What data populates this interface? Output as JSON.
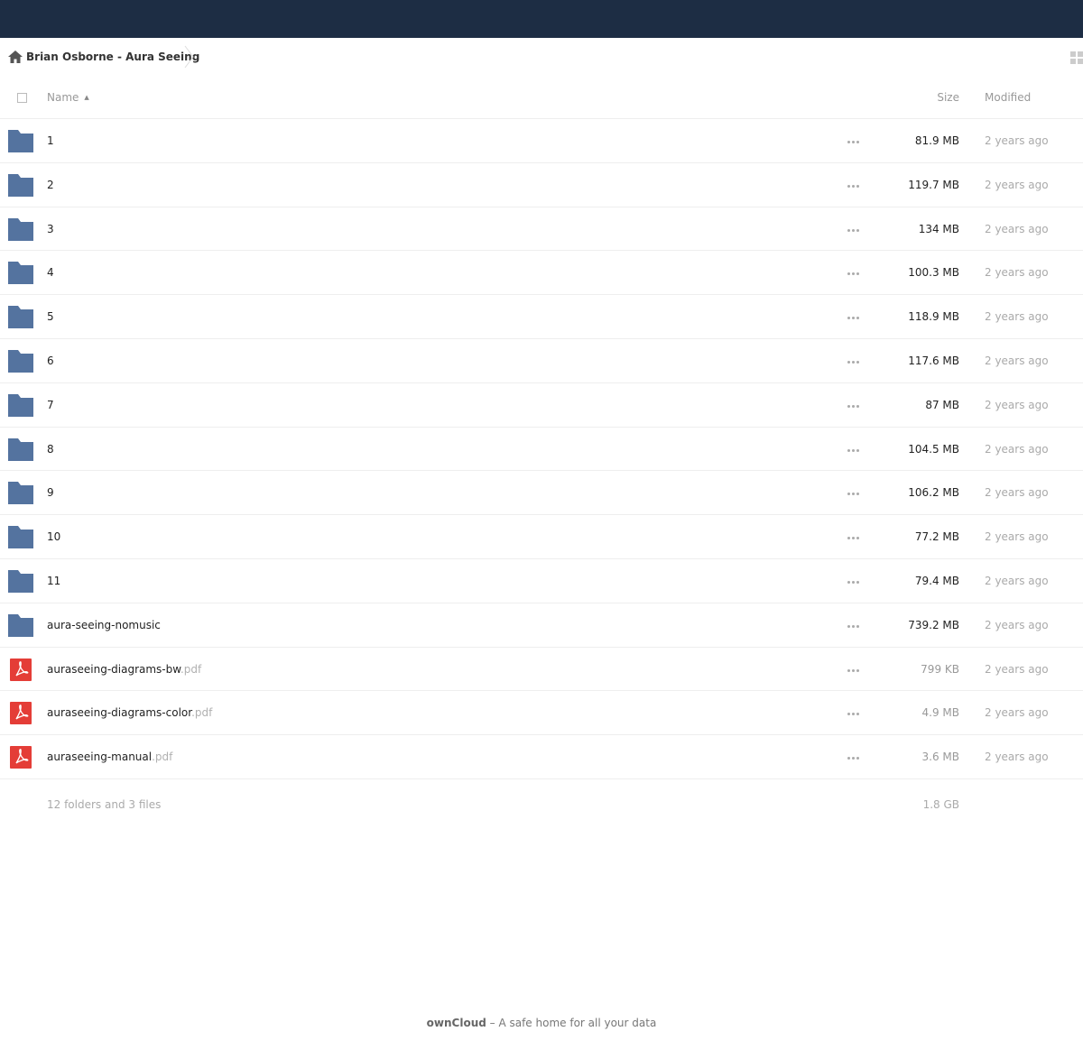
{
  "breadcrumb": {
    "home_icon": "home-icon",
    "folder": "Brian Osborne - Aura Seeing"
  },
  "header": {
    "name": "Name",
    "size": "Size",
    "modified": "Modified"
  },
  "colors": {
    "topbar": "#1d2d44",
    "folder": "#54739f",
    "pdf": "#e43d37"
  },
  "files": [
    {
      "name": "1",
      "ext": "",
      "type": "folder",
      "size": "81.9 MB",
      "modified": "2 years ago"
    },
    {
      "name": "2",
      "ext": "",
      "type": "folder",
      "size": "119.7 MB",
      "modified": "2 years ago"
    },
    {
      "name": "3",
      "ext": "",
      "type": "folder",
      "size": "134 MB",
      "modified": "2 years ago"
    },
    {
      "name": "4",
      "ext": "",
      "type": "folder",
      "size": "100.3 MB",
      "modified": "2 years ago"
    },
    {
      "name": "5",
      "ext": "",
      "type": "folder",
      "size": "118.9 MB",
      "modified": "2 years ago"
    },
    {
      "name": "6",
      "ext": "",
      "type": "folder",
      "size": "117.6 MB",
      "modified": "2 years ago"
    },
    {
      "name": "7",
      "ext": "",
      "type": "folder",
      "size": "87 MB",
      "modified": "2 years ago"
    },
    {
      "name": "8",
      "ext": "",
      "type": "folder",
      "size": "104.5 MB",
      "modified": "2 years ago"
    },
    {
      "name": "9",
      "ext": "",
      "type": "folder",
      "size": "106.2 MB",
      "modified": "2 years ago"
    },
    {
      "name": "10",
      "ext": "",
      "type": "folder",
      "size": "77.2 MB",
      "modified": "2 years ago"
    },
    {
      "name": "11",
      "ext": "",
      "type": "folder",
      "size": "79.4 MB",
      "modified": "2 years ago"
    },
    {
      "name": "aura-seeing-nomusic",
      "ext": "",
      "type": "folder",
      "size": "739.2 MB",
      "modified": "2 years ago"
    },
    {
      "name": "auraseeing-diagrams-bw",
      "ext": ".pdf",
      "type": "pdf",
      "size": "799 KB",
      "modified": "2 years ago"
    },
    {
      "name": "auraseeing-diagrams-color",
      "ext": ".pdf",
      "type": "pdf",
      "size": "4.9 MB",
      "modified": "2 years ago"
    },
    {
      "name": "auraseeing-manual",
      "ext": ".pdf",
      "type": "pdf",
      "size": "3.6 MB",
      "modified": "2 years ago"
    }
  ],
  "summary": {
    "text": "12 folders and 3 files",
    "total": "1.8 GB"
  },
  "footer": {
    "brand": "ownCloud",
    "tagline": " – A safe home for all your data"
  }
}
